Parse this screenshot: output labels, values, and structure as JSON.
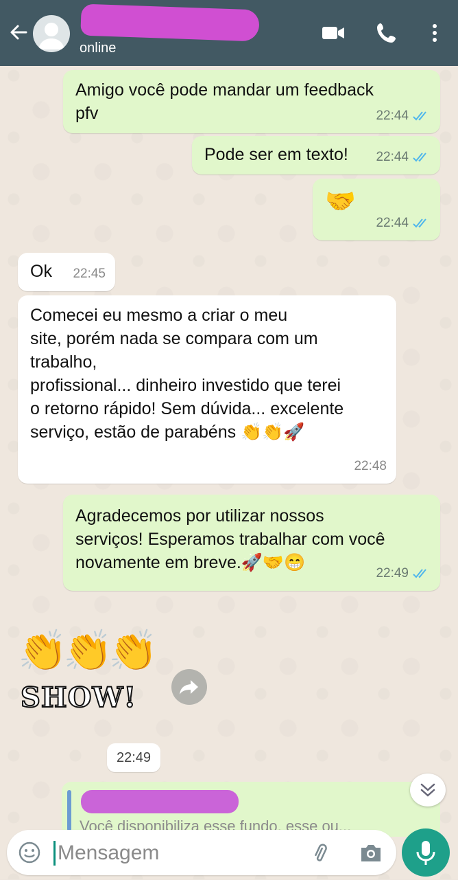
{
  "header": {
    "contact_name": "",
    "status": "online"
  },
  "messages": [
    {
      "text": "Amigo você pode mandar um feedback\npfv",
      "time": "22:44"
    },
    {
      "text": "Pode ser em texto!",
      "time": "22:44"
    },
    {
      "text": "🤝",
      "time": "22:44"
    },
    {
      "text": "Ok",
      "time": "22:45"
    },
    {
      "text": "Comecei eu mesmo a criar o meu\nsite, porém nada se compara com um\ntrabalho,\n profissional... dinheiro investido que terei\no retorno rápido! Sem dúvida... excelente\nserviço, estão de parabéns 👏👏🚀",
      "time": "22:48"
    },
    {
      "text": "Agradecemos por utilizar nossos\nserviços! Esperamos trabalhar com você\nnovamente em breve.🚀🤝😁",
      "time": "22:49"
    }
  ],
  "sticker": {
    "emoji": "👏👏👏",
    "text": "SHOW!"
  },
  "date_chip": "22:49",
  "reply_preview": {
    "text": "Você disponibiliza esse fundo, esse ou..."
  },
  "input": {
    "placeholder": "Mensagem"
  }
}
